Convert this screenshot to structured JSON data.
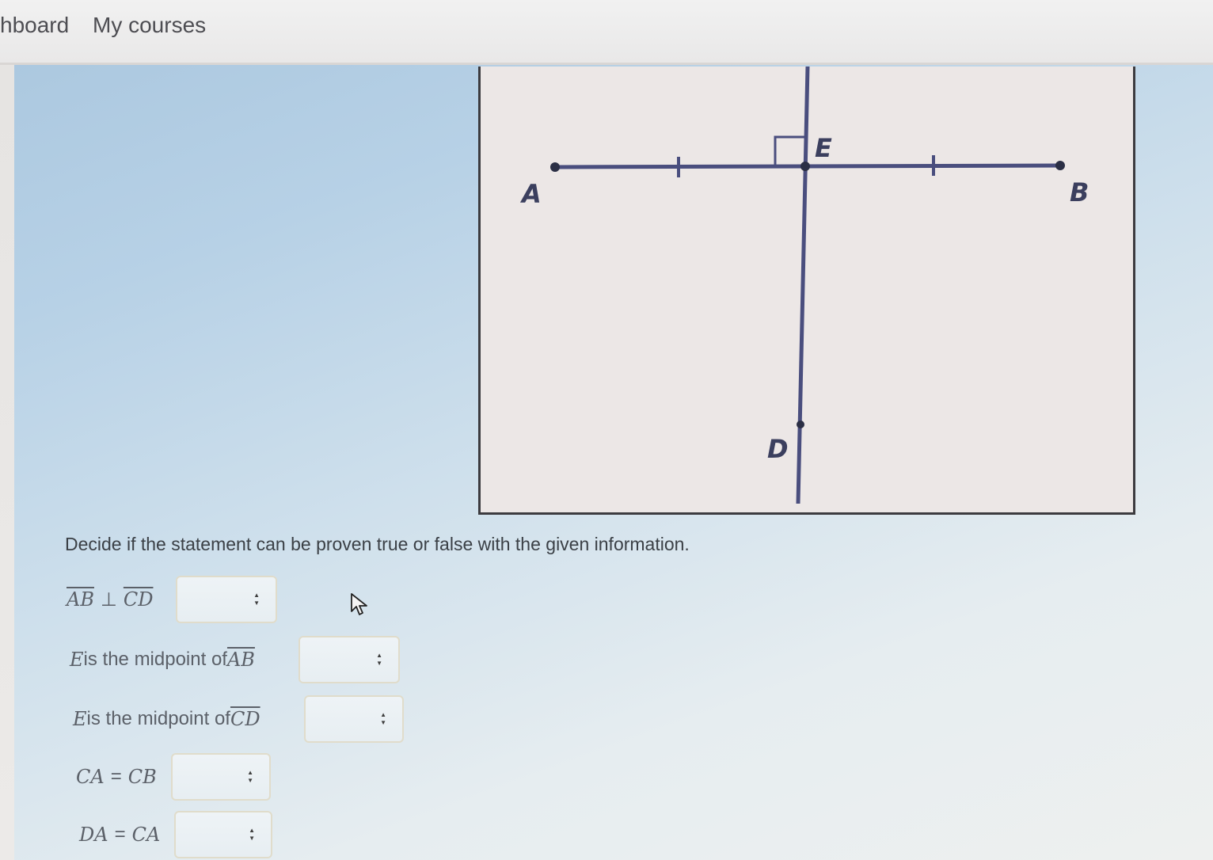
{
  "nav": {
    "dashboard_label": "hboard",
    "my_courses_label": "My courses"
  },
  "figure": {
    "labels": {
      "A": "A",
      "B": "B",
      "D": "D",
      "E": "E"
    },
    "stroke_color": "#4a4e7e",
    "point_color": "#2b2f45"
  },
  "question": {
    "prompt": "Decide if the statement can be proven true or false with the given information.",
    "statements": [
      {
        "segments": [
          [
            "ol",
            "AB"
          ],
          [
            "op",
            "⊥"
          ],
          [
            "ol",
            "CD"
          ]
        ],
        "selected": ""
      },
      {
        "segments": [
          [
            "m",
            "E"
          ],
          [
            "t",
            " is the midpoint of "
          ],
          [
            "ol",
            "AB"
          ]
        ],
        "selected": ""
      },
      {
        "segments": [
          [
            "m",
            "E"
          ],
          [
            "t",
            " is the midpoint of "
          ],
          [
            "ol",
            "CD"
          ]
        ],
        "selected": ""
      },
      {
        "segments": [
          [
            "m",
            "CA"
          ],
          [
            "op",
            "="
          ],
          [
            "m",
            "CB"
          ]
        ],
        "selected": ""
      },
      {
        "segments": [
          [
            "m",
            "DA"
          ],
          [
            "op",
            "="
          ],
          [
            "m",
            "CA"
          ]
        ],
        "selected": ""
      }
    ]
  }
}
